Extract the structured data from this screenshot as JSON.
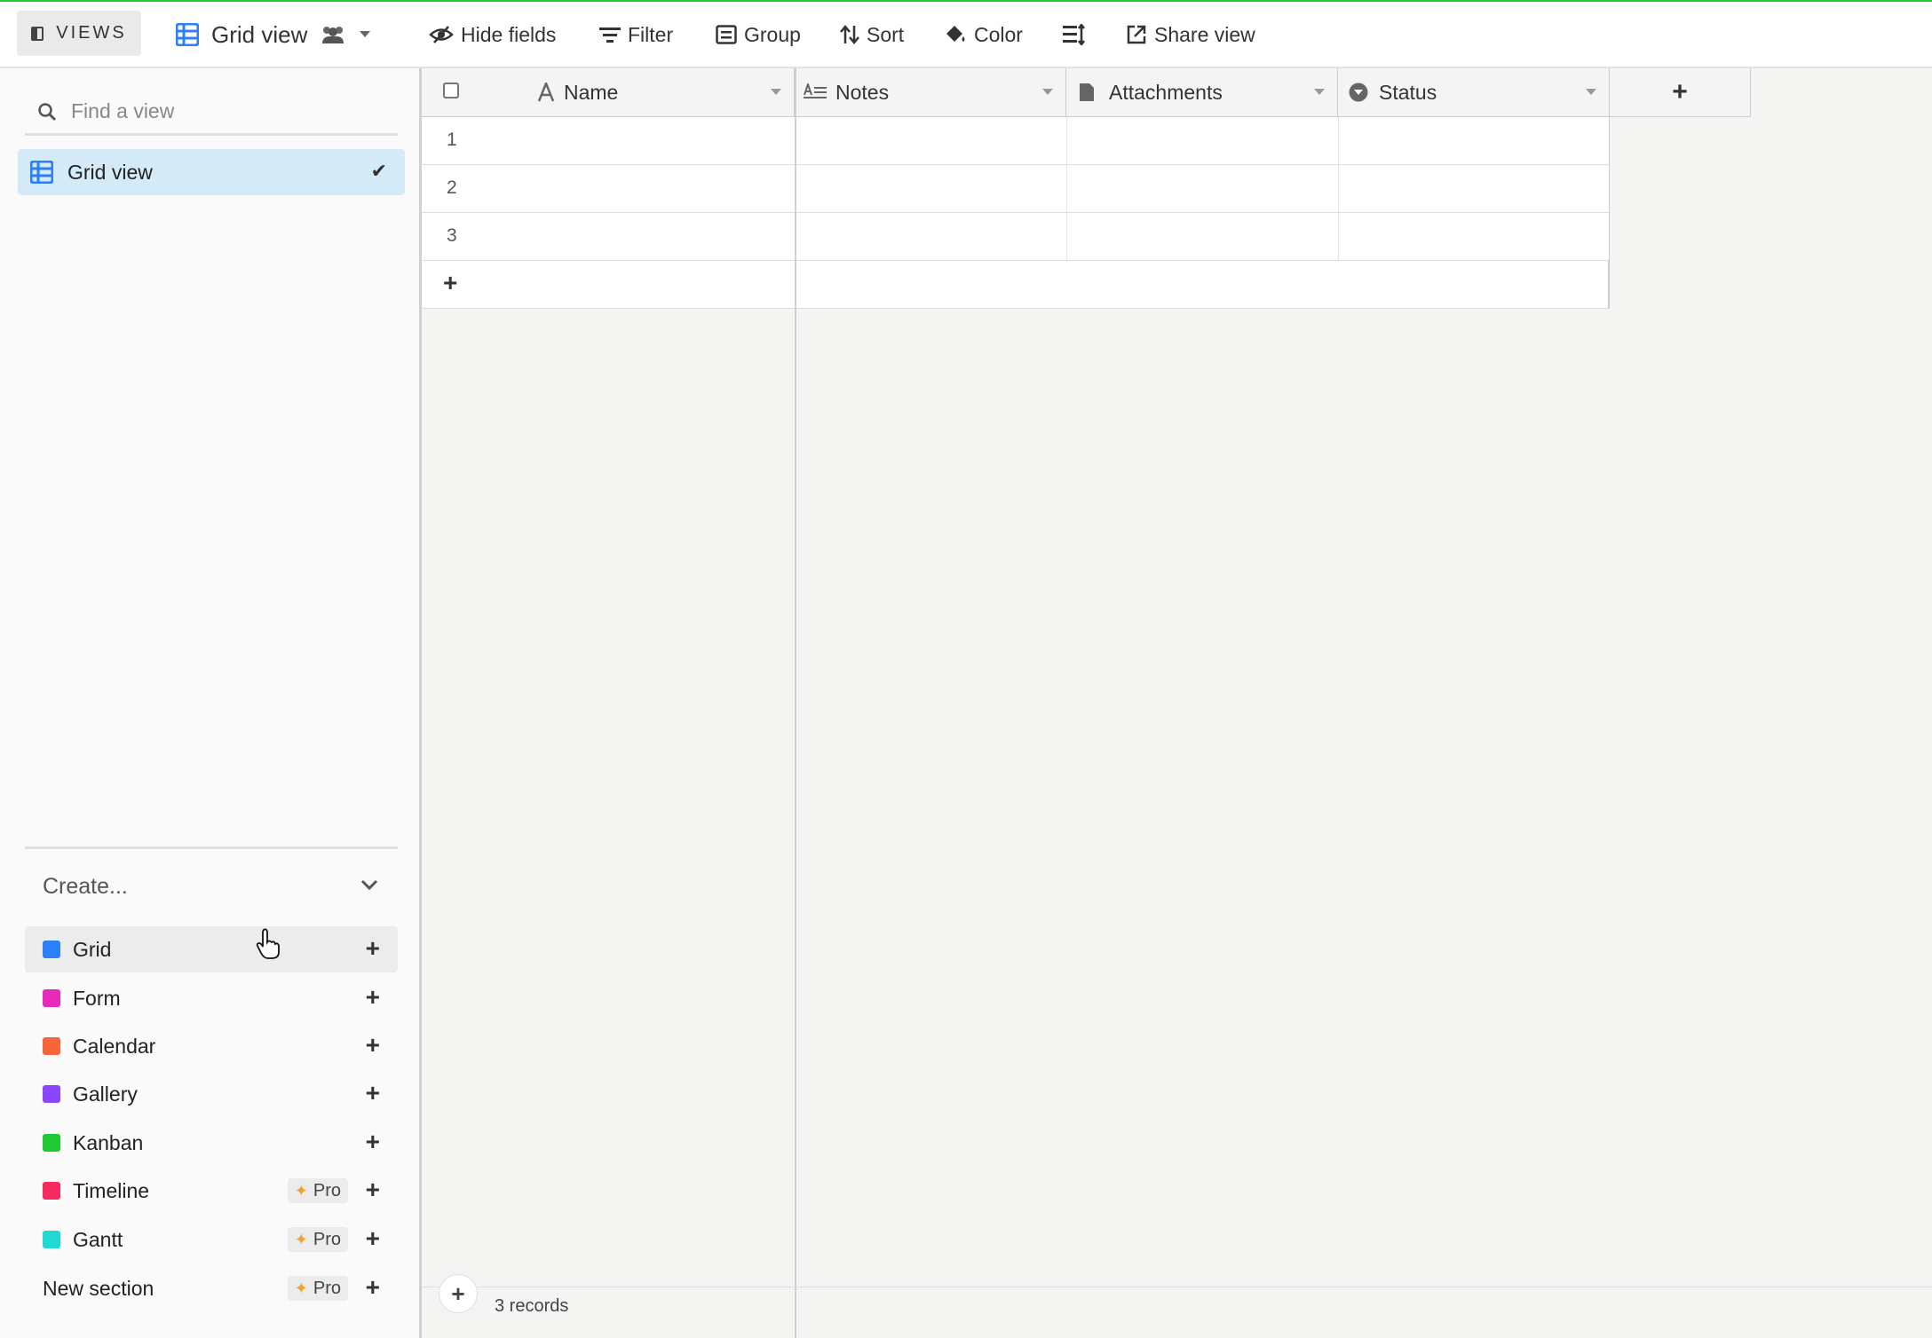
{
  "toolbar": {
    "views_label": "VIEWS",
    "view_name": "Grid view",
    "hide_fields": "Hide fields",
    "filter": "Filter",
    "group": "Group",
    "sort": "Sort",
    "color": "Color",
    "share": "Share view"
  },
  "sidebar": {
    "search_placeholder": "Find a view",
    "active_view": "Grid view",
    "create_label": "Create...",
    "view_types": [
      {
        "label": "Grid",
        "color": "#2d7ff9"
      },
      {
        "label": "Form",
        "color": "#e929ba"
      },
      {
        "label": "Calendar",
        "color": "#f7653b"
      },
      {
        "label": "Gallery",
        "color": "#8b46ff"
      },
      {
        "label": "Kanban",
        "color": "#20c933"
      },
      {
        "label": "Timeline",
        "color": "#f82b60",
        "badge": "Pro"
      },
      {
        "label": "Gantt",
        "color": "#20d9d2",
        "badge": "Pro"
      },
      {
        "label": "New section",
        "badge": "Pro"
      }
    ]
  },
  "grid": {
    "columns": [
      {
        "name": "Name",
        "icon": "text-a-icon"
      },
      {
        "name": "Notes",
        "icon": "long-text-icon"
      },
      {
        "name": "Attachments",
        "icon": "document-icon"
      },
      {
        "name": "Status",
        "icon": "single-select-icon"
      }
    ],
    "rows": [
      "1",
      "2",
      "3"
    ],
    "add_column": "+",
    "add_row": "+",
    "record_count": "3 records"
  }
}
